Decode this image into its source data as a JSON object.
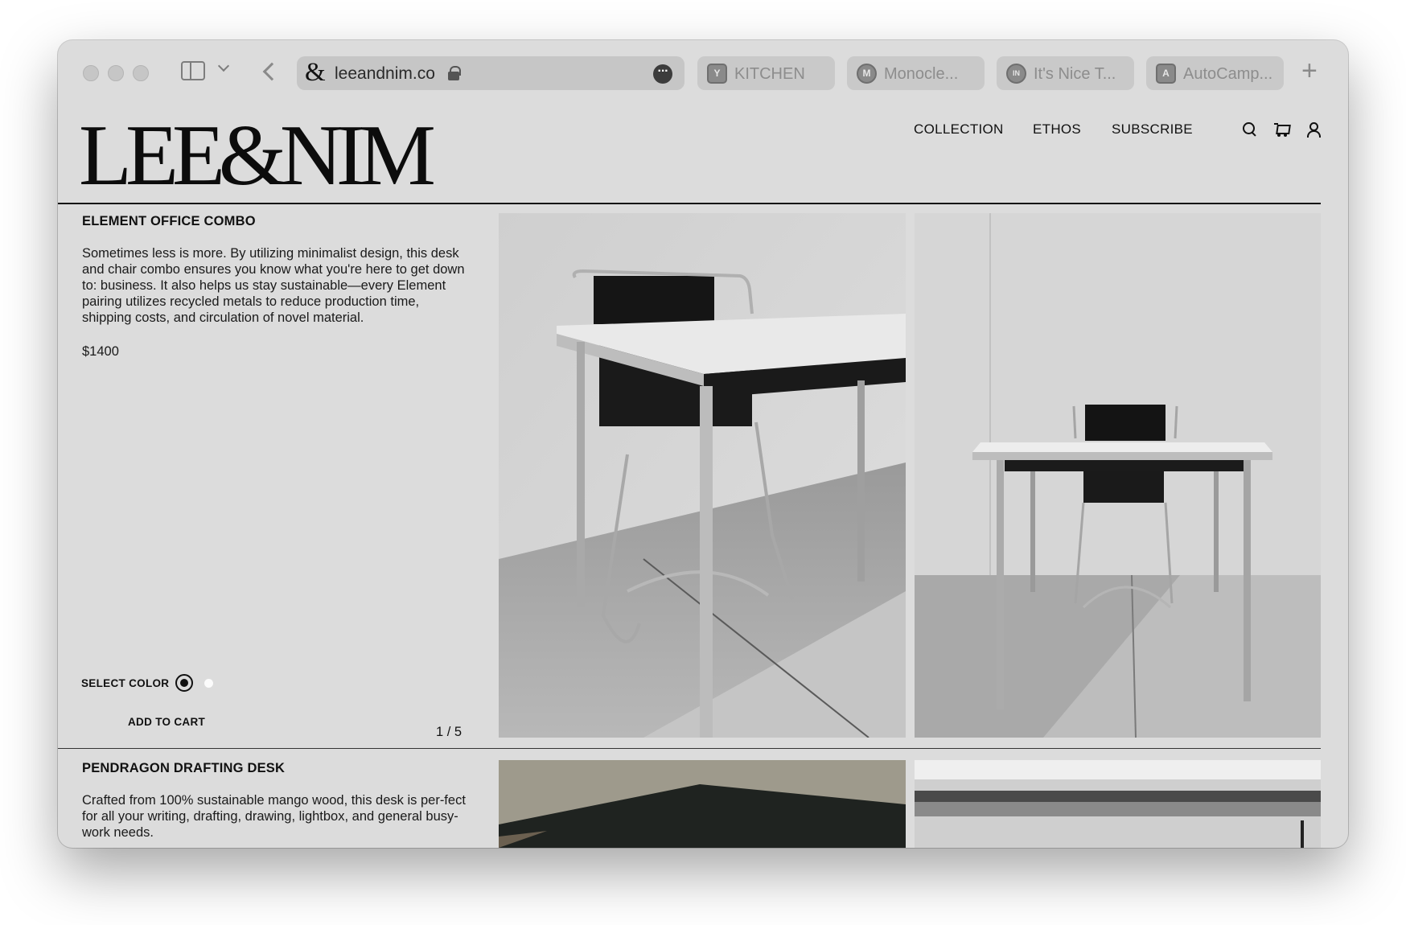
{
  "browser": {
    "url": "leeandnim.co",
    "site_favicon": "&",
    "tabs": [
      {
        "label": "KITCHEN",
        "favicon": "Y"
      },
      {
        "label": "Monocle...",
        "favicon": "M"
      },
      {
        "label": "It's Nice T...",
        "favicon": "IN"
      },
      {
        "label": "AutoCamp...",
        "favicon": "A"
      }
    ]
  },
  "header": {
    "logo": "LEE&NIM",
    "nav": [
      "COLLECTION",
      "ETHOS",
      "SUBSCRIBE"
    ],
    "icons": [
      "search-icon",
      "cart-icon",
      "user-icon"
    ]
  },
  "products": [
    {
      "title": "ELEMENT OFFICE COMBO",
      "description": "Sometimes less is more. By utilizing minimalist design, this desk and chair combo ensures you know what you're here to get down to: business. It also helps us stay sustainable—every Element pairing utilizes recycled metals to reduce production time, shipping costs, and circulation of novel material.",
      "price": "$1400",
      "select_color_label": "SELECT COLOR",
      "add_to_cart_label": "ADD TO CART",
      "image_counter": "1 / 5",
      "colors": [
        "#111111",
        "#fbfbfb"
      ]
    },
    {
      "title": "PENDRAGON DRAFTING DESK",
      "description": "Crafted from 100% sustainable mango wood, this desk is per-fect for all your writing, drafting, drawing, lightbox, and general busy-work needs."
    }
  ]
}
